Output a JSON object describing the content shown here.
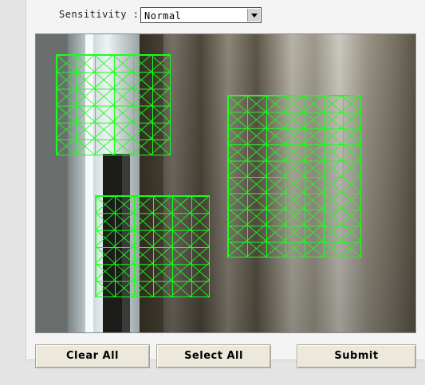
{
  "sensitivity": {
    "label": "Sensitivity :",
    "selected": "Normal"
  },
  "camera": {
    "description_icon": "camera-view"
  },
  "buttons": {
    "clear_all": "Clear All",
    "select_all": "Select All",
    "submit": "Submit"
  },
  "colors": {
    "grid": "#19ff19",
    "button_bg": "#ece8dc",
    "panel_bg": "#f4f4f4"
  }
}
